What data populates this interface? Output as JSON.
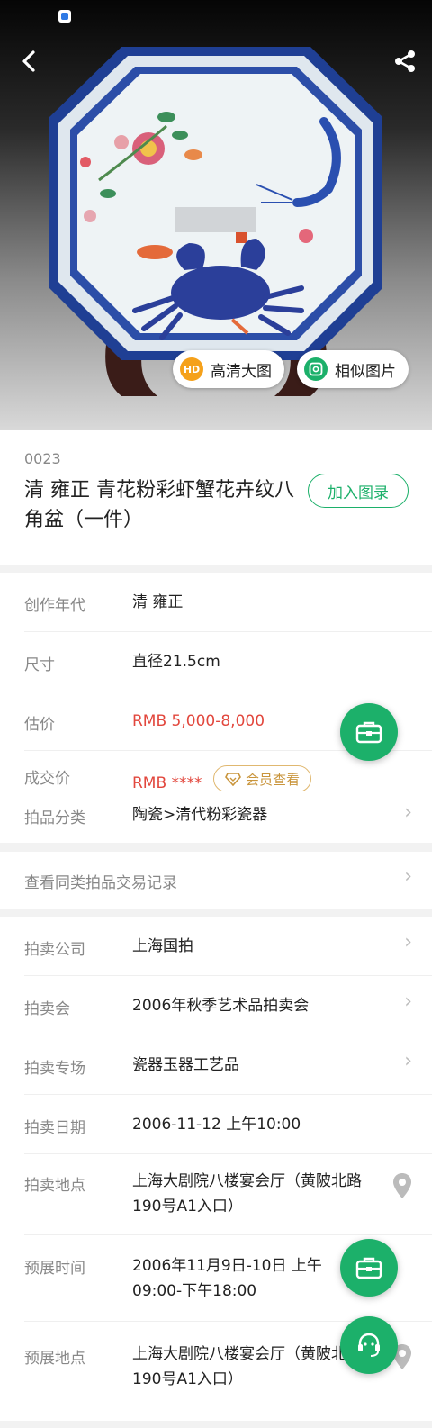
{
  "hero": {
    "hd_badge": "HD",
    "hd_label": "高清大图",
    "similar_label": "相似图片"
  },
  "lot": {
    "number": "0023",
    "title": "清 雍正 青花粉彩虾蟹花卉纹八角盆（一件）",
    "add_catalog": "加入图录"
  },
  "details": [
    {
      "label": "创作年代",
      "value": "清 雍正"
    },
    {
      "label": "尺寸",
      "value": "直径21.5cm"
    },
    {
      "label": "估价",
      "value": "RMB  5,000-8,000"
    },
    {
      "label": "成交价",
      "value": "RMB ****",
      "member_btn": "会员查看"
    },
    {
      "label": "拍品分类",
      "value": "陶瓷>清代粉彩瓷器"
    }
  ],
  "history_link": "查看同类拍品交易记录",
  "auction": [
    {
      "label": "拍卖公司",
      "value": "上海国拍"
    },
    {
      "label": "拍卖会",
      "value": "2006年秋季艺术品拍卖会"
    },
    {
      "label": "拍卖专场",
      "value": "瓷器玉器工艺品"
    },
    {
      "label": "拍卖日期",
      "value": "2006-11-12 上午10:00"
    },
    {
      "label": "拍卖地点",
      "value": "上海大剧院八楼宴会厅（黄陂北路190号A1入口）"
    },
    {
      "label": "预展时间",
      "value": "2006年11月9日-10日 上午09:00-下午18:00"
    },
    {
      "label": "预展地点",
      "value": "上海大剧院八楼宴会厅（黄陂北路190号A1入口）"
    }
  ],
  "colors": {
    "accent": "#1cb06a",
    "price_red": "#e2473d",
    "member_gold": "#c9953c"
  }
}
